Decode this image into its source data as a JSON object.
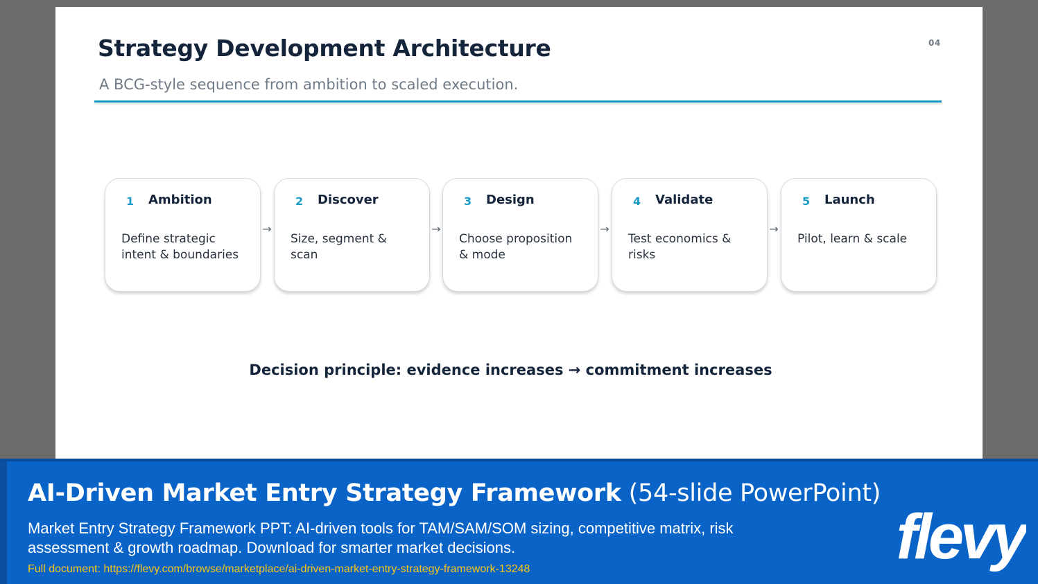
{
  "slide": {
    "title": "Strategy Development Architecture",
    "subtitle": "A BCG-style sequence from ambition to scaled execution.",
    "page_number": "04",
    "steps": [
      {
        "number": "1",
        "title": "Ambition",
        "description": "Define strategic intent & boundaries"
      },
      {
        "number": "2",
        "title": "Discover",
        "description": "Size, segment & scan"
      },
      {
        "number": "3",
        "title": "Design",
        "description": "Choose proposition & mode"
      },
      {
        "number": "4",
        "title": "Validate",
        "description": "Test economics & risks"
      },
      {
        "number": "5",
        "title": "Launch",
        "description": "Pilot, learn & scale"
      }
    ],
    "arrow_glyph": "→",
    "principle": "Decision principle: evidence increases → commitment increases"
  },
  "banner": {
    "title_bold": "AI-Driven Market Entry Strategy Framework",
    "title_light": "(54-slide PowerPoint)",
    "description": "Market Entry Strategy Framework PPT: AI-driven tools for TAM/SAM/SOM sizing, competitive matrix, risk assessment & growth roadmap. Download for smarter market decisions.",
    "link": "Full document: https://flevy.com/browse/marketplace/ai-driven-market-entry-strategy-framework-13248",
    "logo_text": "flevy"
  },
  "colors": {
    "accent": "#1a9bc6",
    "title": "#14243a",
    "banner_bg": "#0a64c8",
    "link": "#f5c518"
  }
}
